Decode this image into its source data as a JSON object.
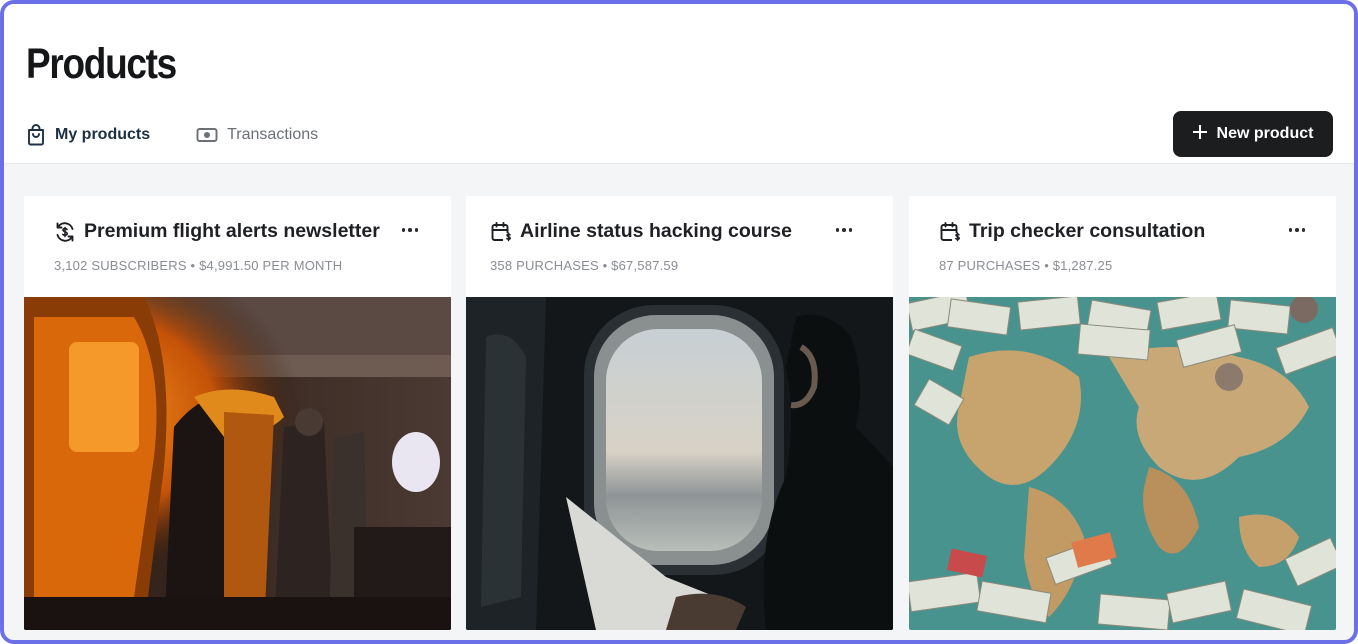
{
  "page": {
    "title": "Products"
  },
  "tabs": [
    {
      "label": "My products",
      "icon": "shopping-bag-icon",
      "active": true
    },
    {
      "label": "Transactions",
      "icon": "banknote-icon",
      "active": false
    }
  ],
  "actions": {
    "new_product_label": "New product",
    "new_product_icon": "plus-icon"
  },
  "products": [
    {
      "title": "Premium flight alerts newsletter",
      "icon": "recurring-dollar-icon",
      "meta": "3,102 SUBSCRIBERS • $4,991.50 PER MONTH",
      "image": "airplane-cabin-sunset-photo"
    },
    {
      "title": "Airline status hacking course",
      "icon": "calendar-dollar-icon",
      "meta": "358 PURCHASES • $67,587.59",
      "image": "airplane-window-passenger-photo"
    },
    {
      "title": "Trip checker consultation",
      "icon": "calendar-dollar-icon",
      "meta": "87 PURCHASES • $1,287.25",
      "image": "world-map-banknotes-photo"
    }
  ],
  "colors": {
    "accent_border": "#6b70e8",
    "button_bg": "#1c1d1f",
    "active_tab": "#1c3044"
  }
}
